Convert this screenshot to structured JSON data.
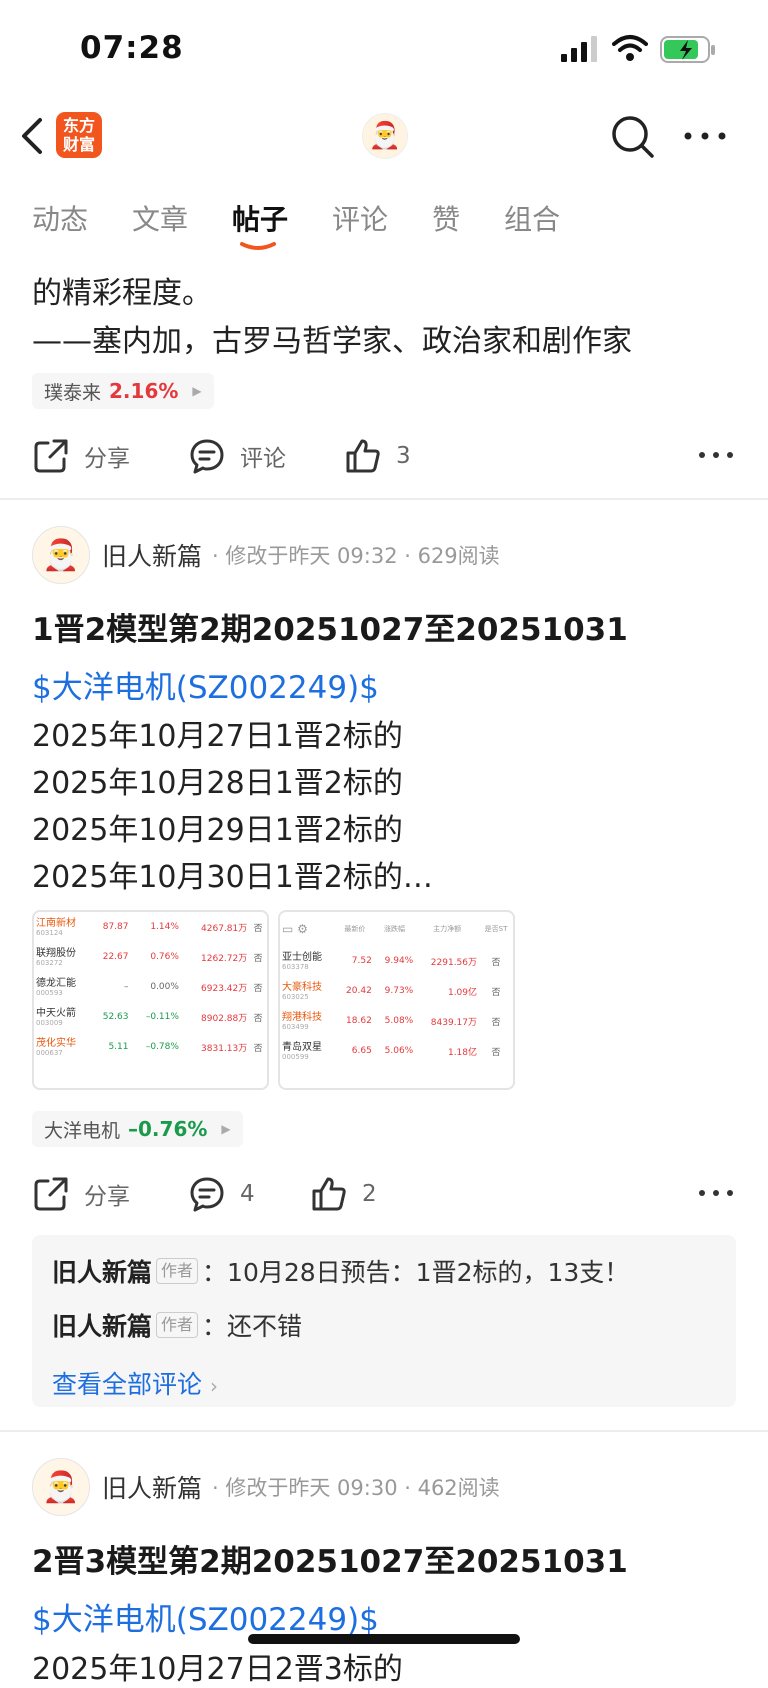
{
  "status_bar": {
    "time": "07:28"
  },
  "nav": {
    "logo_text": "东方财富"
  },
  "tabs": [
    {
      "label": "动态",
      "active": false
    },
    {
      "label": "文章",
      "active": false
    },
    {
      "label": "帖子",
      "active": true
    },
    {
      "label": "评论",
      "active": false
    },
    {
      "label": "赞",
      "active": false
    },
    {
      "label": "组合",
      "active": false
    }
  ],
  "post0": {
    "text_line1": "的精彩程度。",
    "text_line2": "——塞内加，古罗马哲学家、政治家和剧作家",
    "stock_tag": {
      "name": "璞泰来",
      "change": "2.16%",
      "change_color": "#e4393c"
    },
    "share_label": "分享",
    "comment_label": "评论",
    "like_count": "3"
  },
  "post1": {
    "author": "旧人新篇",
    "meta": "· 修改于昨天 09:32 · 629阅读",
    "title": "1晋2模型第2期20251027至20251031",
    "stock_link": "$大洋电机(SZ002249)$",
    "lines": [
      "2025年10月27日1晋2标的",
      "2025年10月28日1晋2标的",
      "2025年10月29日1晋2标的",
      "2025年10月30日1晋2标的…"
    ],
    "thumb1_rows": [
      {
        "name": "江南新材",
        "code": "603124",
        "price": "87.87",
        "chg": "1.14%",
        "flow": "4267.81万",
        "st": "否",
        "hl": true,
        "color": "red"
      },
      {
        "name": "联翔股份",
        "code": "603272",
        "price": "22.67",
        "chg": "0.76%",
        "flow": "1262.72万",
        "st": "否",
        "hl": false,
        "color": "red"
      },
      {
        "name": "德龙汇能",
        "code": "000593",
        "price": "–",
        "chg": "0.00%",
        "flow": "6923.42万",
        "st": "否",
        "hl": false,
        "color": "gray"
      },
      {
        "name": "中天火箭",
        "code": "003009",
        "price": "52.63",
        "chg": "–0.11%",
        "flow": "8902.88万",
        "st": "否",
        "hl": false,
        "color": "green"
      },
      {
        "name": "茂化实华",
        "code": "000637",
        "price": "5.11",
        "chg": "–0.78%",
        "flow": "3831.13万",
        "st": "否",
        "hl": true,
        "color": "green"
      }
    ],
    "thumb2_header": [
      "最新价",
      "涨跌幅",
      "主力净额",
      "是否ST"
    ],
    "thumb2_rows": [
      {
        "name": "亚士创能",
        "code": "603378",
        "price": "7.52",
        "chg": "9.94%",
        "flow": "2291.56万",
        "st": "否",
        "hl": false
      },
      {
        "name": "大豪科技",
        "code": "603025",
        "price": "20.42",
        "chg": "9.73%",
        "flow": "1.09亿",
        "st": "否",
        "hl": true
      },
      {
        "name": "翔港科技",
        "code": "603499",
        "price": "18.62",
        "chg": "5.08%",
        "flow": "8439.17万",
        "st": "否",
        "hl": true
      },
      {
        "name": "青岛双星",
        "code": "000599",
        "price": "6.65",
        "chg": "5.06%",
        "flow": "1.18亿",
        "st": "否",
        "hl": false
      }
    ],
    "stock_tag": {
      "name": "大洋电机",
      "change": "–0.76%",
      "change_color": "#1a9a4b"
    },
    "share_label": "分享",
    "comment_count": "4",
    "like_count": "2",
    "comments": [
      {
        "author": "旧人新篇",
        "badge": "作者",
        "text": "10月28日预告：1晋2标的，13支！"
      },
      {
        "author": "旧人新篇",
        "badge": "作者",
        "text": "还不错"
      }
    ],
    "view_all": "查看全部评论"
  },
  "post2": {
    "author": "旧人新篇",
    "meta": "· 修改于昨天 09:30 · 462阅读",
    "title": "2晋3模型第2期20251027至20251031",
    "stock_link": "$大洋电机(SZ002249)$",
    "first_line": "2025年10月27日2晋3标的"
  }
}
